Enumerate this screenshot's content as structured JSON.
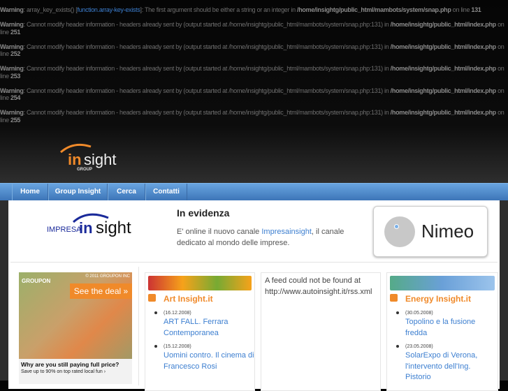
{
  "warnings": [
    {
      "label": "Warning",
      "msg": ": array_key_exists() [",
      "link": "function.array-key-exists",
      "msg2": "]: The first argument should be either a string or an integer in ",
      "file": "/home/insightg/public_html/mambots/system/snap.php",
      "on": " on line ",
      "line": "131"
    },
    {
      "label": "Warning",
      "msg": ": Cannot modify header information - headers already sent by (output started at /home/insightg/public_html/mambots/system/snap.php:131) in ",
      "file": "/home/insightg/public_html/index.php",
      "on": " on line ",
      "line": "251"
    },
    {
      "label": "Warning",
      "msg": ": Cannot modify header information - headers already sent by (output started at /home/insightg/public_html/mambots/system/snap.php:131) in ",
      "file": "/home/insightg/public_html/index.php",
      "on": " on line ",
      "line": "252"
    },
    {
      "label": "Warning",
      "msg": ": Cannot modify header information - headers already sent by (output started at /home/insightg/public_html/mambots/system/snap.php:131) in ",
      "file": "/home/insightg/public_html/index.php",
      "on": " on line ",
      "line": "253"
    },
    {
      "label": "Warning",
      "msg": ": Cannot modify header information - headers already sent by (output started at /home/insightg/public_html/mambots/system/snap.php:131) in ",
      "file": "/home/insightg/public_html/index.php",
      "on": " on line ",
      "line": "254"
    },
    {
      "label": "Warning",
      "msg": ": Cannot modify header information - headers already sent by (output started at /home/insightg/public_html/mambots/system/snap.php:131) in ",
      "file": "/home/insightg/public_html/index.php",
      "on": " on line ",
      "line": "255"
    }
  ],
  "logo": {
    "in": "in",
    "sight": "sight",
    "group": "GROUP"
  },
  "nav": [
    "Home",
    "Group Insight",
    "Cerca",
    "Contatti"
  ],
  "featured": {
    "logo_prefix": "IMPRESA",
    "logo_in": "in",
    "logo_sight": "sight",
    "title": "In evidenza",
    "text1": "E' online il nuovo canale ",
    "link": "Impresainsight",
    "text2": ", il canale dedicato al mondo delle imprese.",
    "nimeo": "Nimeo"
  },
  "ad": {
    "brand": "GROUPON",
    "copyright": "© 2011 GROUPON INC",
    "cta": "See the deal »",
    "headline": "Why are you still paying full price?",
    "sub": "Save up to 90% on top rated local fun ›"
  },
  "columns": [
    {
      "title": "Art Insight.it",
      "items": [
        {
          "date": "(16.12.2008)",
          "title": "ART FALL. Ferrara Contemporanea"
        },
        {
          "date": "(15.12.2008)",
          "title": "Uomini contro. Il cinema di Francesco Rosi"
        }
      ]
    },
    {
      "nofeed": "A feed could not be found at http://www.autoinsight.it/rss.xml"
    },
    {
      "title": "Energy Insight.it",
      "items": [
        {
          "date": "(30.05.2008)",
          "title": "Topolino e la fusione fredda"
        },
        {
          "date": "(23.05.2008)",
          "title": "SolarExpo di Verona, l'intervento dell'Ing. Pistorio"
        }
      ]
    }
  ],
  "colors": {
    "nav": "#4a88c8",
    "accent": "#f08a2a",
    "link": "#3d7fd0"
  }
}
